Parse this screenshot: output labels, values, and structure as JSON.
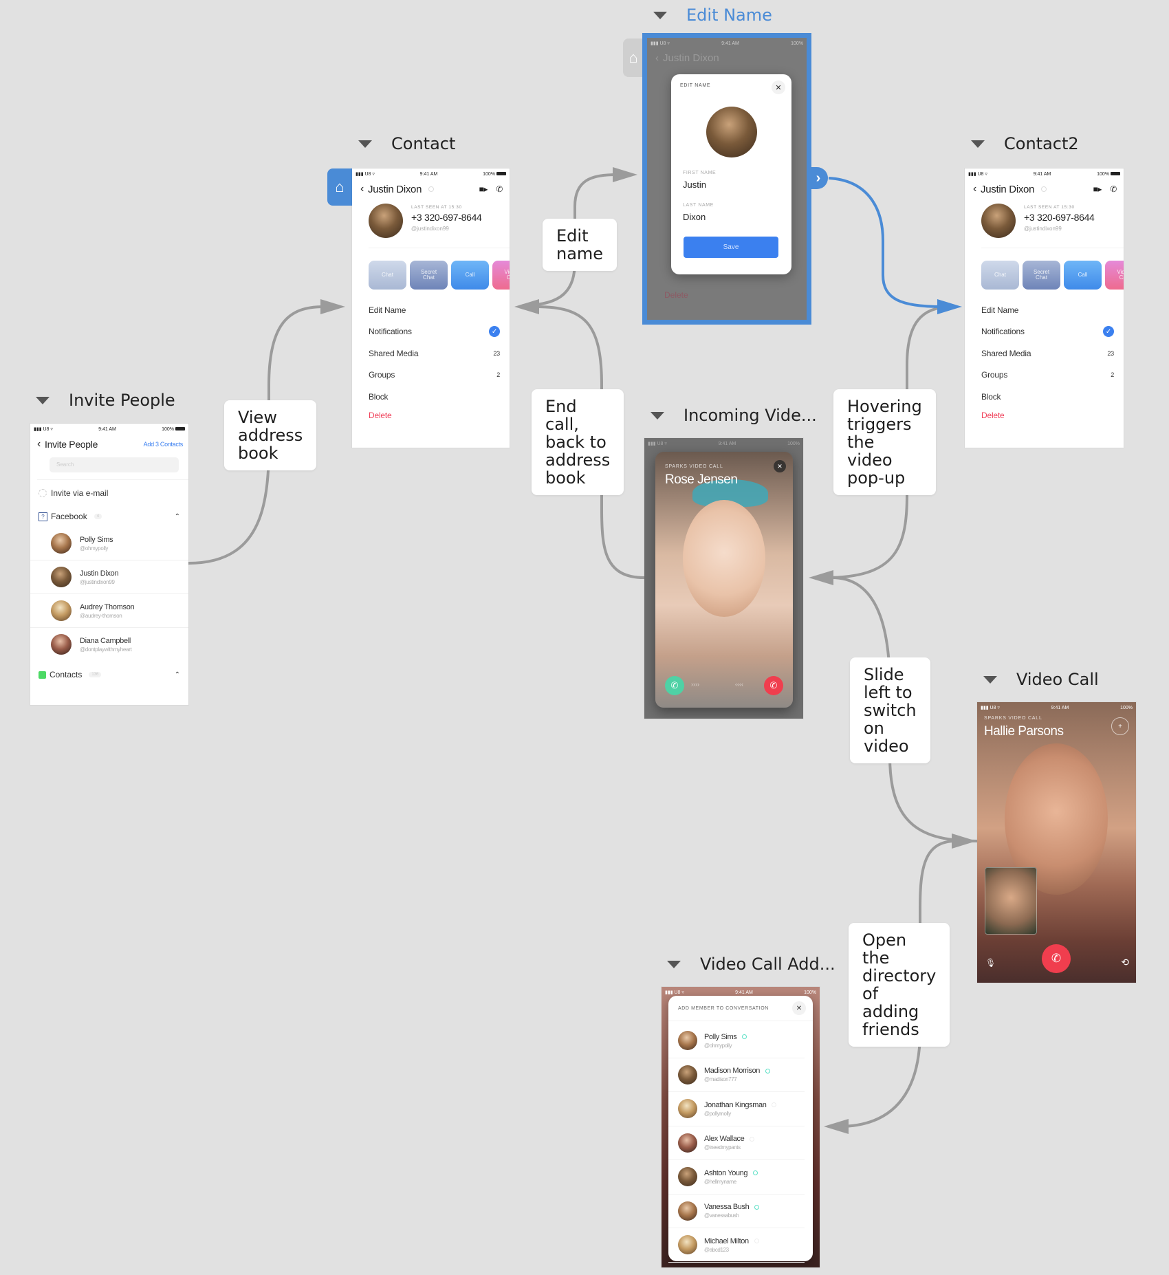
{
  "boards": {
    "invite_people": {
      "label": "Invite People"
    },
    "contact": {
      "label": "Contact"
    },
    "edit_name": {
      "label": "Edit Name"
    },
    "contact2": {
      "label": "Contact2"
    },
    "incoming_video": {
      "label": "Incoming Vide..."
    },
    "video_call": {
      "label": "Video Call"
    },
    "video_call_add": {
      "label": "Video Call Add..."
    }
  },
  "status_bar": {
    "carrier": "▮▮▮ U8 ▿",
    "time": "9:41 AM",
    "battery": "100%"
  },
  "invite_screen": {
    "title": "Invite People",
    "add_action": "Add 3 Contacts",
    "search_placeholder": "Search",
    "invite_email": "Invite via e-mail",
    "facebook_section": "Facebook",
    "facebook_count": "4",
    "people": [
      {
        "name": "Polly Sims",
        "handle": "@ohmypolly"
      },
      {
        "name": "Justin Dixon",
        "handle": "@justindixon99"
      },
      {
        "name": "Audrey Thomson",
        "handle": "@audrey-thomson"
      },
      {
        "name": "Diana Campbell",
        "handle": "@dontplaywithmyheart"
      }
    ],
    "contacts_section": "Contacts",
    "contacts_count": "136"
  },
  "contact_screen": {
    "name": "Justin Dixon",
    "last_seen": "LAST SEEN AT 15:30",
    "phone": "+3 320-697-8644",
    "handle": "@justindixon99",
    "actions": [
      "Chat",
      "Secret Chat",
      "Call",
      "Video Call"
    ],
    "menu": [
      {
        "label": "Edit Name",
        "value": ""
      },
      {
        "label": "Notifications",
        "value": "check"
      },
      {
        "label": "Shared Media",
        "value": "23"
      },
      {
        "label": "Groups",
        "value": "2"
      },
      {
        "label": "Block",
        "value": ""
      },
      {
        "label": "Delete",
        "value": ""
      }
    ]
  },
  "edit_name_modal": {
    "title": "EDIT NAME",
    "first_name_label": "FIRST NAME",
    "first_name": "Justin",
    "last_name_label": "LAST NAME",
    "last_name": "Dixon",
    "save_label": "Save",
    "bg_delete": "Delete"
  },
  "incoming_call": {
    "caption": "SPARKS VIDEO CALL",
    "caller": "Rose Jensen",
    "slide_hint_right": "››››",
    "slide_hint_left": "‹‹‹‹"
  },
  "video_call": {
    "caption": "SPARKS VIDEO CALL",
    "caller": "Hallie Parsons"
  },
  "add_member": {
    "title": "ADD MEMBER TO CONVERSATION",
    "members": [
      {
        "name": "Polly Sims",
        "handle": "@ohmypolly",
        "online": true
      },
      {
        "name": "Madison Morrison",
        "handle": "@madison777",
        "online": true
      },
      {
        "name": "Jonathan Kingsman",
        "handle": "@pollymolly",
        "online": false
      },
      {
        "name": "Alex Wallace",
        "handle": "@ineedmypants",
        "online": false
      },
      {
        "name": "Ashton Young",
        "handle": "@hellmyname",
        "online": true
      },
      {
        "name": "Vanessa Bush",
        "handle": "@vanessabush",
        "online": true
      },
      {
        "name": "Michael Milton",
        "handle": "@abcd123",
        "online": false
      }
    ]
  },
  "notes": {
    "view_address_book": "View\naddress\nbook",
    "edit_name": "Edit\nname",
    "end_call": "End\ncall,\nback to\naddress\nbook",
    "hovering": "Hovering\ntriggers\nthe\nvideo\npop-up",
    "slide_left": "Slide\nleft to\nswitch\non\nvideo",
    "open_directory": "Open\nthe\ndirectory\nof\nadding\nfriends"
  },
  "colors": {
    "canvas": "#e1e1e1",
    "selected": "#4a8bd6",
    "link": "#9b9b9b",
    "accent": "#3b80ef",
    "danger": "#f0415a"
  }
}
